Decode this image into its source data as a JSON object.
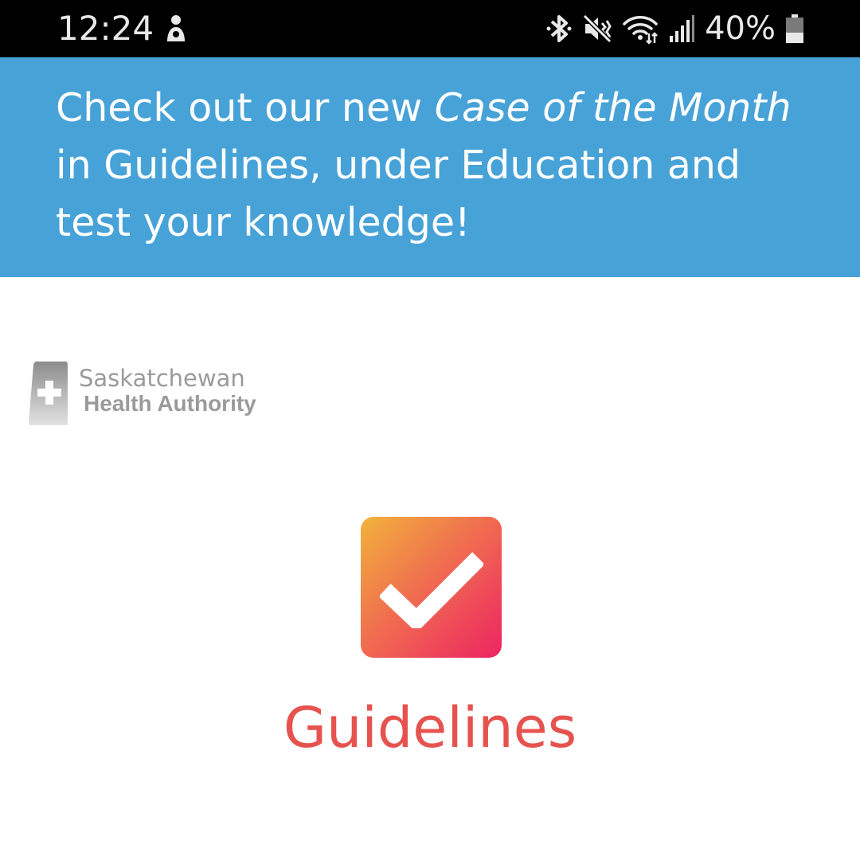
{
  "status_bar": {
    "time": "12:24",
    "battery_percent": "40%",
    "icons": [
      "notification-person-icon",
      "bluetooth-icon",
      "mute-icon",
      "wifi-icon",
      "signal-icon",
      "battery-icon"
    ],
    "battery_level": 0.4
  },
  "banner": {
    "text_before": "Check out our new ",
    "text_italic": "Case of the Month",
    "text_after": " in Guidelines, under Education and test your knowledge!",
    "background_color": "#47a2d8"
  },
  "logo": {
    "line1": "Saskatchewan",
    "line2": "Health Authority"
  },
  "app": {
    "icon": "checkmark-icon",
    "label": "Guidelines",
    "label_color": "#e6534f",
    "gradient": [
      "#f2b33c",
      "#f06f4f",
      "#ed2462"
    ]
  }
}
